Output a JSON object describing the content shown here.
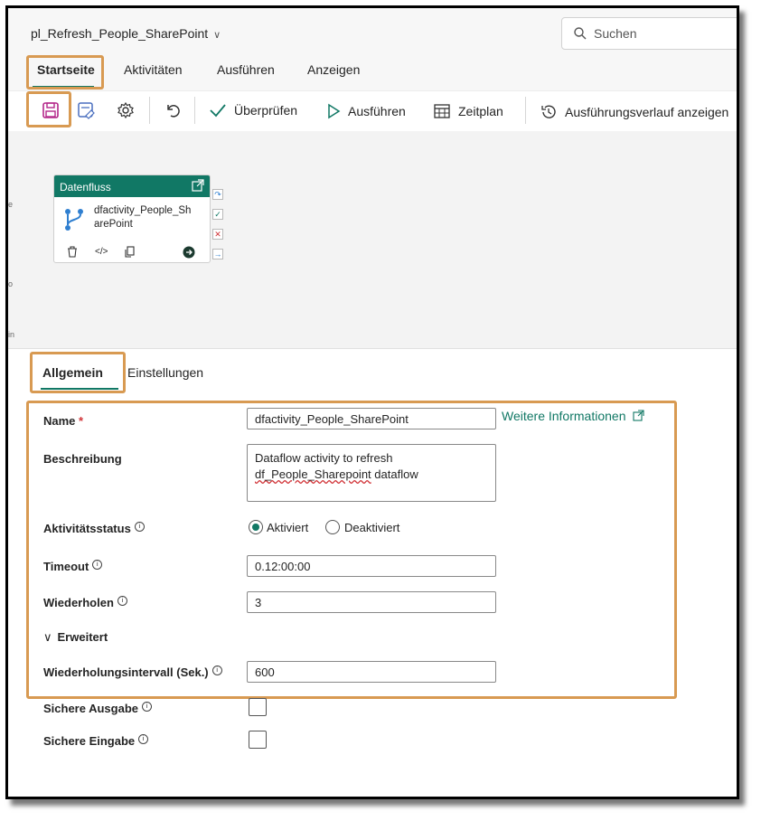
{
  "header": {
    "title": "pl_Refresh_People_SharePoint",
    "search_placeholder": "Suchen"
  },
  "menu_tabs": [
    "Startseite",
    "Aktivitäten",
    "Ausführen",
    "Anzeigen"
  ],
  "active_menu_tab": "Startseite",
  "toolbar": {
    "validate": "Überprüfen",
    "run": "Ausführen",
    "schedule": "Zeitplan",
    "history": "Ausführungsverlauf anzeigen"
  },
  "activity": {
    "type": "Datenfluss",
    "name": "dfactivity_People_SharePoint"
  },
  "panel_tabs": [
    "Allgemein",
    "Einstellungen"
  ],
  "active_panel_tab": "Allgemein",
  "form": {
    "name_label": "Name",
    "required_mark": "*",
    "name_value": "dfactivity_People_SharePoint",
    "more_info_link": "Weitere Informationen",
    "description_label": "Beschreibung",
    "description_line1": "Dataflow activity to refresh",
    "description_line2_a": "df_People_Sharepoint",
    "description_line2_b": " dataflow",
    "status_label": "Aktivitätsstatus",
    "status_activated": "Aktiviert",
    "status_deactivated": "Deaktiviert",
    "status_selected": "Aktiviert",
    "timeout_label": "Timeout",
    "timeout_value": "0.12:00:00",
    "retry_label": "Wiederholen",
    "retry_value": "3",
    "advanced_label": "Erweitert",
    "retry_interval_label": "Wiederholungsintervall (Sek.)",
    "retry_interval_value": "600",
    "secure_output_label": "Sichere Ausgabe",
    "secure_input_label": "Sichere Eingabe"
  },
  "colors": {
    "accent": "#117865",
    "highlight": "#d89a52",
    "error": "#d13438"
  }
}
